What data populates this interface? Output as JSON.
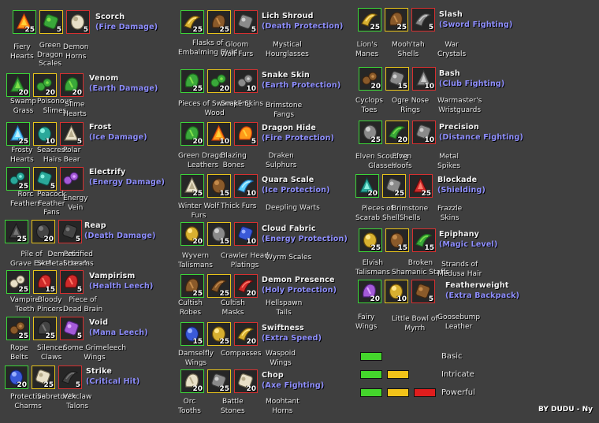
{
  "imbuements": [
    {
      "title": "Scorch",
      "subtitle": "(Fire Damage)",
      "items": [
        {
          "icon": "fiery-hearts-icon",
          "count": "25",
          "name": "Fiery\nHearts"
        },
        {
          "icon": "green-dragon-scales-icon",
          "count": "5",
          "name": "Green\nDragon\nScales"
        },
        {
          "icon": "demon-horns-icon",
          "count": "5",
          "name": "Demon\nHorns"
        }
      ]
    },
    {
      "title": "Venom",
      "subtitle": "(Earth Damage)",
      "items": [
        {
          "icon": "swamp-grass-icon",
          "count": "20",
          "name": "Swamp\nGrass"
        },
        {
          "icon": "poisonous-slimes-icon",
          "count": "20",
          "name": "Poisonous\nSlimes"
        },
        {
          "icon": "slime-hearts-icon",
          "count": "20",
          "name": "Slime\nHearts"
        }
      ]
    },
    {
      "title": "Frost",
      "subtitle": "(Ice Damage)",
      "items": [
        {
          "icon": "frosty-hearts-icon",
          "count": "25",
          "name": "Frosty\nHearts"
        },
        {
          "icon": "seacrest-hairs-icon",
          "count": "10",
          "name": "Seacrest\nHairs"
        },
        {
          "icon": "polar-bear-icon",
          "count": "5",
          "name": "Polar\nBear"
        }
      ]
    },
    {
      "title": "Electrify",
      "subtitle": "(Energy Damage)",
      "items": [
        {
          "icon": "rorc-feathers-icon",
          "count": "25",
          "name": "Rorc\nFeathers"
        },
        {
          "icon": "peacock-feather-fans-icon",
          "count": "5",
          "name": "Peacock\nFeather\nFans"
        },
        {
          "icon": "energy-vein-icon",
          "count": "",
          "name": "Energy\nVein"
        }
      ]
    },
    {
      "title": "Reap",
      "subtitle": "(Death Damage)",
      "items": [
        {
          "icon": "pile-of-grave-earth-icon",
          "count": "25",
          "name": "Pile of\nGrave Earth"
        },
        {
          "icon": "demonic-skeletal-hands-icon",
          "count": "20",
          "name": "Demonic\nSkeletal Hands"
        },
        {
          "icon": "petrified-screams-icon",
          "count": "5",
          "name": "Petrified\nScreams"
        }
      ]
    },
    {
      "title": "Vampirism",
      "subtitle": "(Health Leech)",
      "items": [
        {
          "icon": "vampire-teeth-icon",
          "count": "25",
          "name": "Vampire\nTeeth"
        },
        {
          "icon": "bloody-pincers-icon",
          "count": "15",
          "name": "Bloody\nPincers"
        },
        {
          "icon": "piece-of-dead-brain-icon",
          "count": "5",
          "name": "Piece of\nDead Brain"
        }
      ]
    },
    {
      "title": "Void",
      "subtitle": "(Mana Leech)",
      "items": [
        {
          "icon": "rope-belts-icon",
          "count": "25",
          "name": "Rope\nBelts"
        },
        {
          "icon": "silencer-claws-icon",
          "count": "25",
          "name": "Silencer\nClaws"
        },
        {
          "icon": "some-grimeleech-wings-icon",
          "count": "5",
          "name": "Some Grimeleech\nWings"
        }
      ]
    },
    {
      "title": "Strike",
      "subtitle": "(Critical Hit)",
      "items": [
        {
          "icon": "protective-charms-icon",
          "count": "20",
          "name": "Protective\nCharms"
        },
        {
          "icon": "sabretooth-icon",
          "count": "25",
          "name": "Sabretooth"
        },
        {
          "icon": "vexclaw-talons-icon",
          "count": "5",
          "name": "Vexclaw\nTalons"
        }
      ]
    },
    {
      "title": "Lich Shroud",
      "subtitle": "(Death Protection)",
      "items": [
        {
          "icon": "flasks-of-embalming-fluid-icon",
          "count": "25",
          "name": "Flasks of\nEmbalming Fluid"
        },
        {
          "icon": "gloom-wolf-furs-icon",
          "count": "25",
          "name": "Gloom\nWolf Furs"
        },
        {
          "icon": "mystical-hourglasses-icon",
          "count": "5",
          "name": "Mystical\nHourglasses"
        }
      ]
    },
    {
      "title": "Snake Skin",
      "subtitle": "(Earth Protection)",
      "items": [
        {
          "icon": "pieces-of-swampling-wood-icon",
          "count": "25",
          "name": "Pieces of Swampling\nWood"
        },
        {
          "icon": "snake-skins-icon",
          "count": "20",
          "name": "Snake Skins"
        },
        {
          "icon": "brimstone-fangs-icon",
          "count": "10",
          "name": "Brimstone\nFangs"
        }
      ]
    },
    {
      "title": "Dragon Hide",
      "subtitle": "(Fire Protection)",
      "items": [
        {
          "icon": "green-dragon-leathers-icon",
          "count": "20",
          "name": "Green Dragon\nLeathers"
        },
        {
          "icon": "blazing-bones-icon",
          "count": "10",
          "name": "Blazing\nBones"
        },
        {
          "icon": "draken-sulphurs-icon",
          "count": "5",
          "name": "Draken\nSulphurs"
        }
      ]
    },
    {
      "title": "Quara Scale",
      "subtitle": "(Ice Protection)",
      "items": [
        {
          "icon": "winter-wolf-furs-icon",
          "count": "25",
          "name": "Winter Wolf\nFurs"
        },
        {
          "icon": "thick-furs-icon",
          "count": "15",
          "name": "Thick Furs"
        },
        {
          "icon": "deepling-warts-icon",
          "count": "10",
          "name": "Deepling Warts"
        }
      ]
    },
    {
      "title": "Cloud Fabric",
      "subtitle": "(Energy Protection)",
      "items": [
        {
          "icon": "wyvern-talismans-icon",
          "count": "20",
          "name": "Wyvern\nTalismans"
        },
        {
          "icon": "crawler-head-platings-icon",
          "count": "15",
          "name": "Crawler Head\nPlatings"
        },
        {
          "icon": "wyrm-scales-icon",
          "count": "10",
          "name": "Wyrm Scales"
        }
      ]
    },
    {
      "title": "Demon Presence",
      "subtitle": "(Holy Protection)",
      "items": [
        {
          "icon": "cultish-robes-icon",
          "count": "25",
          "name": "Cultish\nRobes"
        },
        {
          "icon": "cultish-masks-icon",
          "count": "25",
          "name": "Cultish\nMasks"
        },
        {
          "icon": "hellspawn-tails-icon",
          "count": "20",
          "name": "Hellspawn\nTails"
        }
      ]
    },
    {
      "title": "Swiftness",
      "subtitle": "(Extra Speed)",
      "items": [
        {
          "icon": "damselfly-wings-icon",
          "count": "15",
          "name": "Damselfly\nWings"
        },
        {
          "icon": "compasses-icon",
          "count": "25",
          "name": "Compasses"
        },
        {
          "icon": "waspoid-wings-icon",
          "count": "20",
          "name": "Waspoid\nWings"
        }
      ]
    },
    {
      "title": "Chop",
      "subtitle": "(Axe Fighting)",
      "items": [
        {
          "icon": "orc-tooths-icon",
          "count": "20",
          "name": "Orc\nTooths"
        },
        {
          "icon": "battle-stones-icon",
          "count": "25",
          "name": "Battle\nStones"
        },
        {
          "icon": "moohtant-horns-icon",
          "count": "20",
          "name": "Moohtant\nHorns"
        }
      ]
    },
    {
      "title": "Slash",
      "subtitle": "(Sword Fighting)",
      "items": [
        {
          "icon": "lions-manes-icon",
          "count": "25",
          "name": "Lion's\nManes"
        },
        {
          "icon": "moohtah-shells-icon",
          "count": "25",
          "name": "Mooh'tah\nShells"
        },
        {
          "icon": "war-crystals-icon",
          "count": "5",
          "name": "War\nCrystals"
        }
      ]
    },
    {
      "title": "Bash",
      "subtitle": "(Club Fighting)",
      "items": [
        {
          "icon": "cyclops-toes-icon",
          "count": "20",
          "name": "Cyclops\nToes"
        },
        {
          "icon": "ogre-nose-rings-icon",
          "count": "15",
          "name": "Ogre Nose\nRings"
        },
        {
          "icon": "warmasters-wristguards-icon",
          "count": "10",
          "name": "Warmaster's\nWristguards"
        }
      ]
    },
    {
      "title": "Precision",
      "subtitle": "(Distance Fighting)",
      "items": [
        {
          "icon": "elven-scouting-glasses-icon",
          "count": "25",
          "name": "Elven Scouting\nGlasses"
        },
        {
          "icon": "elven-hoofs-icon",
          "count": "20",
          "name": "Elven\nHoofs"
        },
        {
          "icon": "metal-spikes-icon",
          "count": "10",
          "name": "Metal\nSpikes"
        }
      ]
    },
    {
      "title": "Blockade",
      "subtitle": "(Shielding)",
      "items": [
        {
          "icon": "pieces-of-scarab-shell-icon",
          "count": "20",
          "name": "Pieces of\nScarab Shell"
        },
        {
          "icon": "brimstone-shells-icon",
          "count": "25",
          "name": "Brimstone\nShells"
        },
        {
          "icon": "frazzle-skins-icon",
          "count": "25",
          "name": "Frazzle\nSkins"
        }
      ]
    },
    {
      "title": "Epiphany",
      "subtitle": "(Magic Level)",
      "items": [
        {
          "icon": "elvish-talismans-icon",
          "count": "25",
          "name": "Elvish\nTalismans"
        },
        {
          "icon": "broken-shamanic-staffs-icon",
          "count": "15",
          "name": "Broken\nShamanic Staffs"
        },
        {
          "icon": "strands-of-medusa-hair-icon",
          "count": "15",
          "name": "Strands of\nMedusa Hair"
        }
      ]
    },
    {
      "title": "Featherweight",
      "subtitle": "(Extra Backpack)",
      "items": [
        {
          "icon": "fairy-wings-icon",
          "count": "20",
          "name": "Fairy\nWings"
        },
        {
          "icon": "little-bowl-of-myrrh-icon",
          "count": "10",
          "name": "Little Bowl of\nMyrrh"
        },
        {
          "icon": "goosebump-leather-icon",
          "count": "5",
          "name": "Goosebump\nLeather"
        }
      ]
    }
  ],
  "legend": [
    {
      "label": "Basic",
      "colors": [
        "#44d62c"
      ]
    },
    {
      "label": "Intricate",
      "colors": [
        "#44d62c",
        "#f2c319"
      ]
    },
    {
      "label": "Powerful",
      "colors": [
        "#44d62c",
        "#f2c319",
        "#e01d1d"
      ]
    }
  ],
  "colors": {
    "background": "#3f3f3f",
    "title": "#f2f2f2",
    "subtitle": "#8f8fff",
    "tier1": "#3cd638",
    "tier2": "#e8c41a",
    "tier3": "#d63030"
  },
  "credit": "BY DUDU - Ny"
}
